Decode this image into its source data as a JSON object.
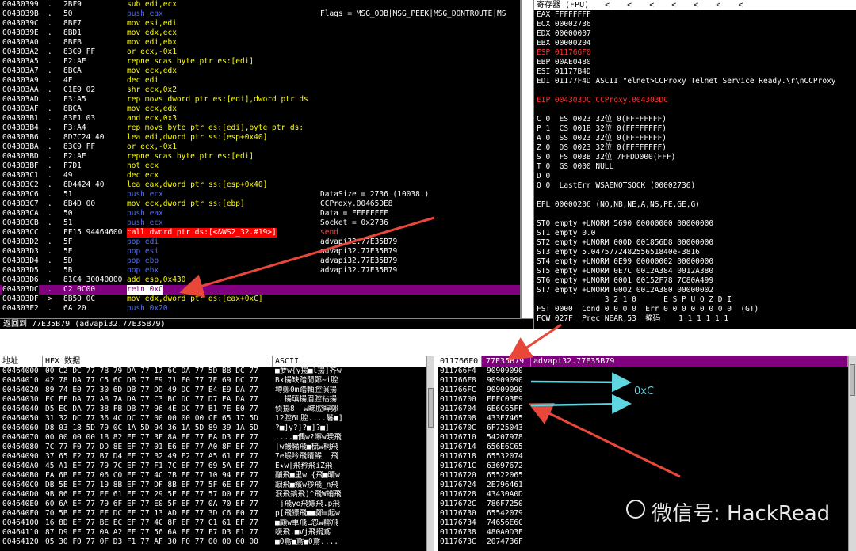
{
  "disasm": {
    "rows": [
      {
        "addr": "00430399",
        "mk": ".",
        "hex": "2BF9",
        "asm": "sub edi,ecx",
        "cls": "ins-mov"
      },
      {
        "addr": "0043039B",
        "mk": ".",
        "hex": "50",
        "asm": "push eax",
        "cls": "ins-push"
      },
      {
        "addr": "0043039C",
        "mk": ".",
        "hex": "8BF7",
        "asm": "mov esi,edi",
        "cls": "ins-mov"
      },
      {
        "addr": "0043039E",
        "mk": ".",
        "hex": "8BD1",
        "asm": "mov edx,ecx",
        "cls": "ins-mov"
      },
      {
        "addr": "004303A0",
        "mk": ".",
        "hex": "8BFB",
        "asm": "mov edi,ebx",
        "cls": "ins-mov"
      },
      {
        "addr": "004303A2",
        "mk": ".",
        "hex": "83C9 FF",
        "asm": "or ecx,-0x1",
        "cls": "ins-mov"
      },
      {
        "addr": "004303A5",
        "mk": ".",
        "hex": "F2:AE",
        "asm": "repne scas byte ptr es:[edi]",
        "cls": "ins-mov"
      },
      {
        "addr": "004303A7",
        "mk": ".",
        "hex": "8BCA",
        "asm": "mov ecx,edx",
        "cls": "ins-mov"
      },
      {
        "addr": "004303A9",
        "mk": ".",
        "hex": "4F",
        "asm": "dec edi",
        "cls": "ins-mov"
      },
      {
        "addr": "004303AA",
        "mk": ".",
        "hex": "C1E9 02",
        "asm": "shr ecx,0x2",
        "cls": "ins-mov"
      },
      {
        "addr": "004303AD",
        "mk": ".",
        "hex": "F3:A5",
        "asm": "rep movs dword ptr es:[edi],dword ptr ds",
        "cls": "ins-mov"
      },
      {
        "addr": "004303AF",
        "mk": ".",
        "hex": "8BCA",
        "asm": "mov ecx,edx",
        "cls": "ins-mov"
      },
      {
        "addr": "004303B1",
        "mk": ".",
        "hex": "83E1 03",
        "asm": "and ecx,0x3",
        "cls": "ins-mov"
      },
      {
        "addr": "004303B4",
        "mk": ".",
        "hex": "F3:A4",
        "asm": "rep movs byte ptr es:[edi],byte ptr ds:",
        "cls": "ins-mov"
      },
      {
        "addr": "004303B6",
        "mk": ".",
        "hex": "8D7C24 40",
        "asm": "lea edi,dword ptr ss:[esp+0x40]",
        "cls": "ins-mov"
      },
      {
        "addr": "004303BA",
        "mk": ".",
        "hex": "83C9 FF",
        "asm": "or ecx,-0x1",
        "cls": "ins-mov"
      },
      {
        "addr": "004303BD",
        "mk": ".",
        "hex": "F2:AE",
        "asm": "repne scas byte ptr es:[edi]",
        "cls": "ins-mov"
      },
      {
        "addr": "004303BF",
        "mk": ".",
        "hex": "F7D1",
        "asm": "not ecx",
        "cls": "ins-mov"
      },
      {
        "addr": "004303C1",
        "mk": ".",
        "hex": "49",
        "asm": "dec ecx",
        "cls": "ins-mov"
      },
      {
        "addr": "004303C2",
        "mk": ".",
        "hex": "8D4424 40",
        "asm": "lea eax,dword ptr ss:[esp+0x40]",
        "cls": "ins-mov"
      },
      {
        "addr": "004303C6",
        "mk": ".",
        "hex": "51",
        "asm": "push ecx",
        "cls": "ins-push"
      },
      {
        "addr": "004303C7",
        "mk": ".",
        "hex": "8B4D 00",
        "asm": "mov ecx,dword ptr ss:[ebp]",
        "cls": "ins-mov"
      },
      {
        "addr": "004303CA",
        "mk": ".",
        "hex": "50",
        "asm": "push eax",
        "cls": "ins-push"
      },
      {
        "addr": "004303CB",
        "mk": ".",
        "hex": "51",
        "asm": "push ecx",
        "cls": "ins-push"
      },
      {
        "addr": "004303CC",
        "mk": ".",
        "hex": "FF15 94464600",
        "asm": "call dword ptr ds:[<&WS2_32.#19>]",
        "cls": "ins-call"
      },
      {
        "addr": "004303D2",
        "mk": ".",
        "hex": "5F",
        "asm": "pop edi",
        "cls": "ins-push"
      },
      {
        "addr": "004303D3",
        "mk": ".",
        "hex": "5E",
        "asm": "pop esi",
        "cls": "ins-push"
      },
      {
        "addr": "004303D4",
        "mk": ".",
        "hex": "5D",
        "asm": "pop ebp",
        "cls": "ins-push"
      },
      {
        "addr": "004303D5",
        "mk": ".",
        "hex": "5B",
        "asm": "pop ebx",
        "cls": "ins-push"
      },
      {
        "addr": "004303D6",
        "mk": ".",
        "hex": "81C4 30040000",
        "asm": "add esp,0x430",
        "cls": "ins-mov"
      },
      {
        "addr": "004303DC",
        "mk": ".",
        "hex": "C2 0C00",
        "asm": "retn 0xC",
        "cls": "ins-ret",
        "sel": true
      },
      {
        "addr": "004303DF",
        "mk": ">",
        "hex": "8B50 0C",
        "asm": "mov edx,dword ptr ds:[eax+0xC]",
        "cls": "ins-mov"
      },
      {
        "addr": "004303E2",
        "mk": ".",
        "hex": "6A 20",
        "asm": "push 0x20",
        "cls": "ins-push"
      }
    ],
    "comments": [
      {
        "row": 1,
        "text": "Flags = MSG_OOB|MSG_PEEK|MSG_DONTROUTE|MS"
      },
      {
        "row": 20,
        "text": "DataSize = 2736 (10038.)"
      },
      {
        "row": 21,
        "text": "CCProxy.00465DE8"
      },
      {
        "row": 22,
        "text": "Data = FFFFFFFF"
      },
      {
        "row": 23,
        "text": "Socket = 0x2736"
      },
      {
        "row": 24,
        "text": "send"
      },
      {
        "row": 25,
        "text": "advapi32.77E35B79"
      },
      {
        "row": 26,
        "text": "advapi32.77E35B79"
      },
      {
        "row": 27,
        "text": "advapi32.77E35B79"
      },
      {
        "row": 28,
        "text": "advapi32.77E35B79"
      }
    ]
  },
  "hint": "返回到 77E35B79 (advapi32.77E35B79)",
  "registers": {
    "title": "寄存器 (FPU)",
    "nav": [
      "<",
      "<",
      "<",
      "<",
      "<",
      "<",
      "<"
    ],
    "lines": [
      {
        "t": "EAX FFFFFFFF"
      },
      {
        "t": "ECX 00002736"
      },
      {
        "t": "EDX 00000007"
      },
      {
        "t": "EBX 00000204"
      },
      {
        "t": "ESP 011766F0",
        "red": true
      },
      {
        "t": "EBP 00AE0480"
      },
      {
        "t": "ESI 01177B4D"
      },
      {
        "t": "EDI 01177F4D ASCII \"elnet>CCProxy Telnet Service Ready.\\r\\nCCProxy "
      },
      {
        "t": ""
      },
      {
        "t": "EIP 004303DC CCProxy.004303DC",
        "red": true
      },
      {
        "t": ""
      },
      {
        "t": "C 0  ES 0023 32位 0(FFFFFFFF)"
      },
      {
        "t": "P 1  CS 001B 32位 0(FFFFFFFF)"
      },
      {
        "t": "A 0  SS 0023 32位 0(FFFFFFFF)"
      },
      {
        "t": "Z 0  DS 0023 32位 0(FFFFFFFF)"
      },
      {
        "t": "S 0  FS 003B 32位 7FFDD000(FFF)"
      },
      {
        "t": "T 0  GS 0000 NULL"
      },
      {
        "t": "D 0"
      },
      {
        "t": "O 0  LastErr WSAENOTSOCK (00002736)"
      },
      {
        "t": ""
      },
      {
        "t": "EFL 00000206 (NO,NB,NE,A,NS,PE,GE,G)"
      },
      {
        "t": ""
      },
      {
        "t": "ST0 empty +UNORM 5690 00000000 00000000"
      },
      {
        "t": "ST1 empty 0.0"
      },
      {
        "t": "ST2 empty +UNORM 000D 001856D8 00000000"
      },
      {
        "t": "ST3 empty 5.047577248255651840e-3816"
      },
      {
        "t": "ST4 empty +UNORM 0E99 00000002 00000000"
      },
      {
        "t": "ST5 empty +UNORM 0E7C 0012A384 0012A380"
      },
      {
        "t": "ST6 empty +UNORM 0001 00152F78 7C80A499"
      },
      {
        "t": "ST7 empty +UNORM 0002 0012A380 00000002"
      },
      {
        "t": "               3 2 1 0      E S P U O Z D I"
      },
      {
        "t": "FST 0000  Cond 0 0 0 0  Err 0 0 0 0 0 0 0 0  (GT)"
      },
      {
        "t": "FCW 027F  Prec NEAR,53  掩码    1 1 1 1 1 1"
      }
    ]
  },
  "dump": {
    "headers": [
      "地址",
      "HEX 数据",
      "ASCII"
    ],
    "rows": [
      {
        "a": "00464000",
        "h": "00 C2 DC 77 7B 79 DA 77 17 6C DA 77 5D BB DC 77",
        "s": "■萝w{y揚■l揚]齐w"
      },
      {
        "a": "00464010",
        "h": "42 78 DA 77 C5 6C DB 77 E9 71 E0 77 7E 69 DC 77",
        "s": "Bx揚缺踏閒鄭~i腔"
      },
      {
        "a": "00464020",
        "h": "89 74 E0 77 30 6D DB 77 DD 49 DC 77 E4 E9 DA 77",
        "s": "墫鄭0m踏軸腔溟揚"
      },
      {
        "a": "00464030",
        "h": "FC EF DA 77 AB 7A DA 77 C3 BC DC 77 D7 EA DA 77",
        "s": "  揚瑱揚眉腔钻揚"
      },
      {
        "a": "00464040",
        "h": "D5 EC DA 77 38 FB DB 77 96 4E DC 77 B1 7E E0 77",
        "s": "侦揚8  w睇腔睅鄭"
      },
      {
        "a": "00464050",
        "h": "31 32 DC 77 36 4C DC 77 00 00 00 00 CF 65 17 5D",
        "s": "12腔6L腔....鬈■]"
      },
      {
        "a": "00464060",
        "h": "D8 03 18 5D 79 0C 1A 5D 94 36 1A 5D 89 39 1A 5D",
        "s": "?■]y?]?■]?■]"
      },
      {
        "a": "00464070",
        "h": "00 00 00 00 1B 82 EF 77 3F 8A EF 77 EA D3 EF 77",
        "s": "....■偶w?嚓w暌飛"
      },
      {
        "a": "00464080",
        "h": "7C 77 F0 77 DD 8E EF 77 01 E6 EF 77 A0 8F EF 77",
        "s": "|w鰻鞴飛■梳w桐飛"
      },
      {
        "a": "00464090",
        "h": "37 65 F2 77 B7 D4 EF 77 B2 49 F2 77 A5 61 EF 77",
        "s": "7e蜈吟飛睛鰈  飛"
      },
      {
        "a": "004640A0",
        "h": "45 A1 EF 77 79 7C EF 77 F1 7C EF 77 69 5A EF 77",
        "s": "E★w|飛矜飛iZ飛"
      },
      {
        "a": "004640B0",
        "h": "FA 6B EF 77 06 C0 EF 77 4C 7B EF 77 10 94 EF 77",
        "s": "黼飛■里wL{飛■晴w"
      },
      {
        "a": "004640C0",
        "h": "DB 5E EF 77 19 8B EF 77 DF 8B EF 77 5F 6E EF 77",
        "s": "蹰飛■嬪w拶飛_n飛"
      },
      {
        "a": "004640D0",
        "h": "9B 86 EF 77 EF 61 EF 77 29 5E EF 77 57 D0 EF 77",
        "s": "泯飛鎬飛)^飛W蛸飛"
      },
      {
        "a": "004640E0",
        "h": "60 6A EF 77 79 6F EF 77 E0 5F EF 77 0A 70 EF 77",
        "s": "`j飛yo飛嫖飛.p飛"
      },
      {
        "a": "004640F0",
        "h": "70 5B EF 77 EF DC EF 77 13 AD EF 77 3D C6 F0 77",
        "s": "p[飛镖飛■■鄭=起w"
      },
      {
        "a": "00464100",
        "h": "16 8D EF 77 BE EC EF 77 4C 8F EF 77 C1 61 EF 77",
        "s": "■顧w車飛L忽w鞹飛"
      },
      {
        "a": "00464110",
        "h": "87 D9 EF 77 0A A2 EF 77 56 6A EF 77 F7 D3 F1 77",
        "s": "噯飛.■Vj飛搦鳶"
      },
      {
        "a": "00464120",
        "h": "05 30 F0 77 0F D3 F1 77 AF 30 F0 77 00 00 00 00",
        "s": "■0鳶■鳶■0鳶...."
      }
    ]
  },
  "stack": {
    "top": {
      "a": "011766F0",
      "v": "77E35B79",
      "c": "advapi32.77E35B79"
    },
    "rows": [
      {
        "a": "011766F4",
        "v": "90909090"
      },
      {
        "a": "011766F8",
        "v": "90909090"
      },
      {
        "a": "011766FC",
        "v": "90909090"
      },
      {
        "a": "01176700",
        "v": "FFFC03E9"
      },
      {
        "a": "01176704",
        "v": "6E6C65FF"
      },
      {
        "a": "01176708",
        "v": "433E7465"
      },
      {
        "a": "0117670C",
        "v": "6F725043"
      },
      {
        "a": "01176710",
        "v": "54207978"
      },
      {
        "a": "01176714",
        "v": "656E6C65"
      },
      {
        "a": "01176718",
        "v": "65532074"
      },
      {
        "a": "0117671C",
        "v": "63697672"
      },
      {
        "a": "01176720",
        "v": "65522065"
      },
      {
        "a": "01176724",
        "v": "2E796461"
      },
      {
        "a": "01176728",
        "v": "43430A0D"
      },
      {
        "a": "0117672C",
        "v": "786F7250"
      },
      {
        "a": "01176730",
        "v": "65542079"
      },
      {
        "a": "01176734",
        "v": "74656E6C"
      },
      {
        "a": "01176738",
        "v": "480A0D3E"
      },
      {
        "a": "0117673C",
        "v": "2074736F"
      }
    ]
  },
  "annotation": "0xC",
  "watermark": "微信号: HackRead",
  "colors": {
    "arrow": "#e8473a",
    "cyan": "#5fd7e0",
    "purple": "#800080"
  }
}
